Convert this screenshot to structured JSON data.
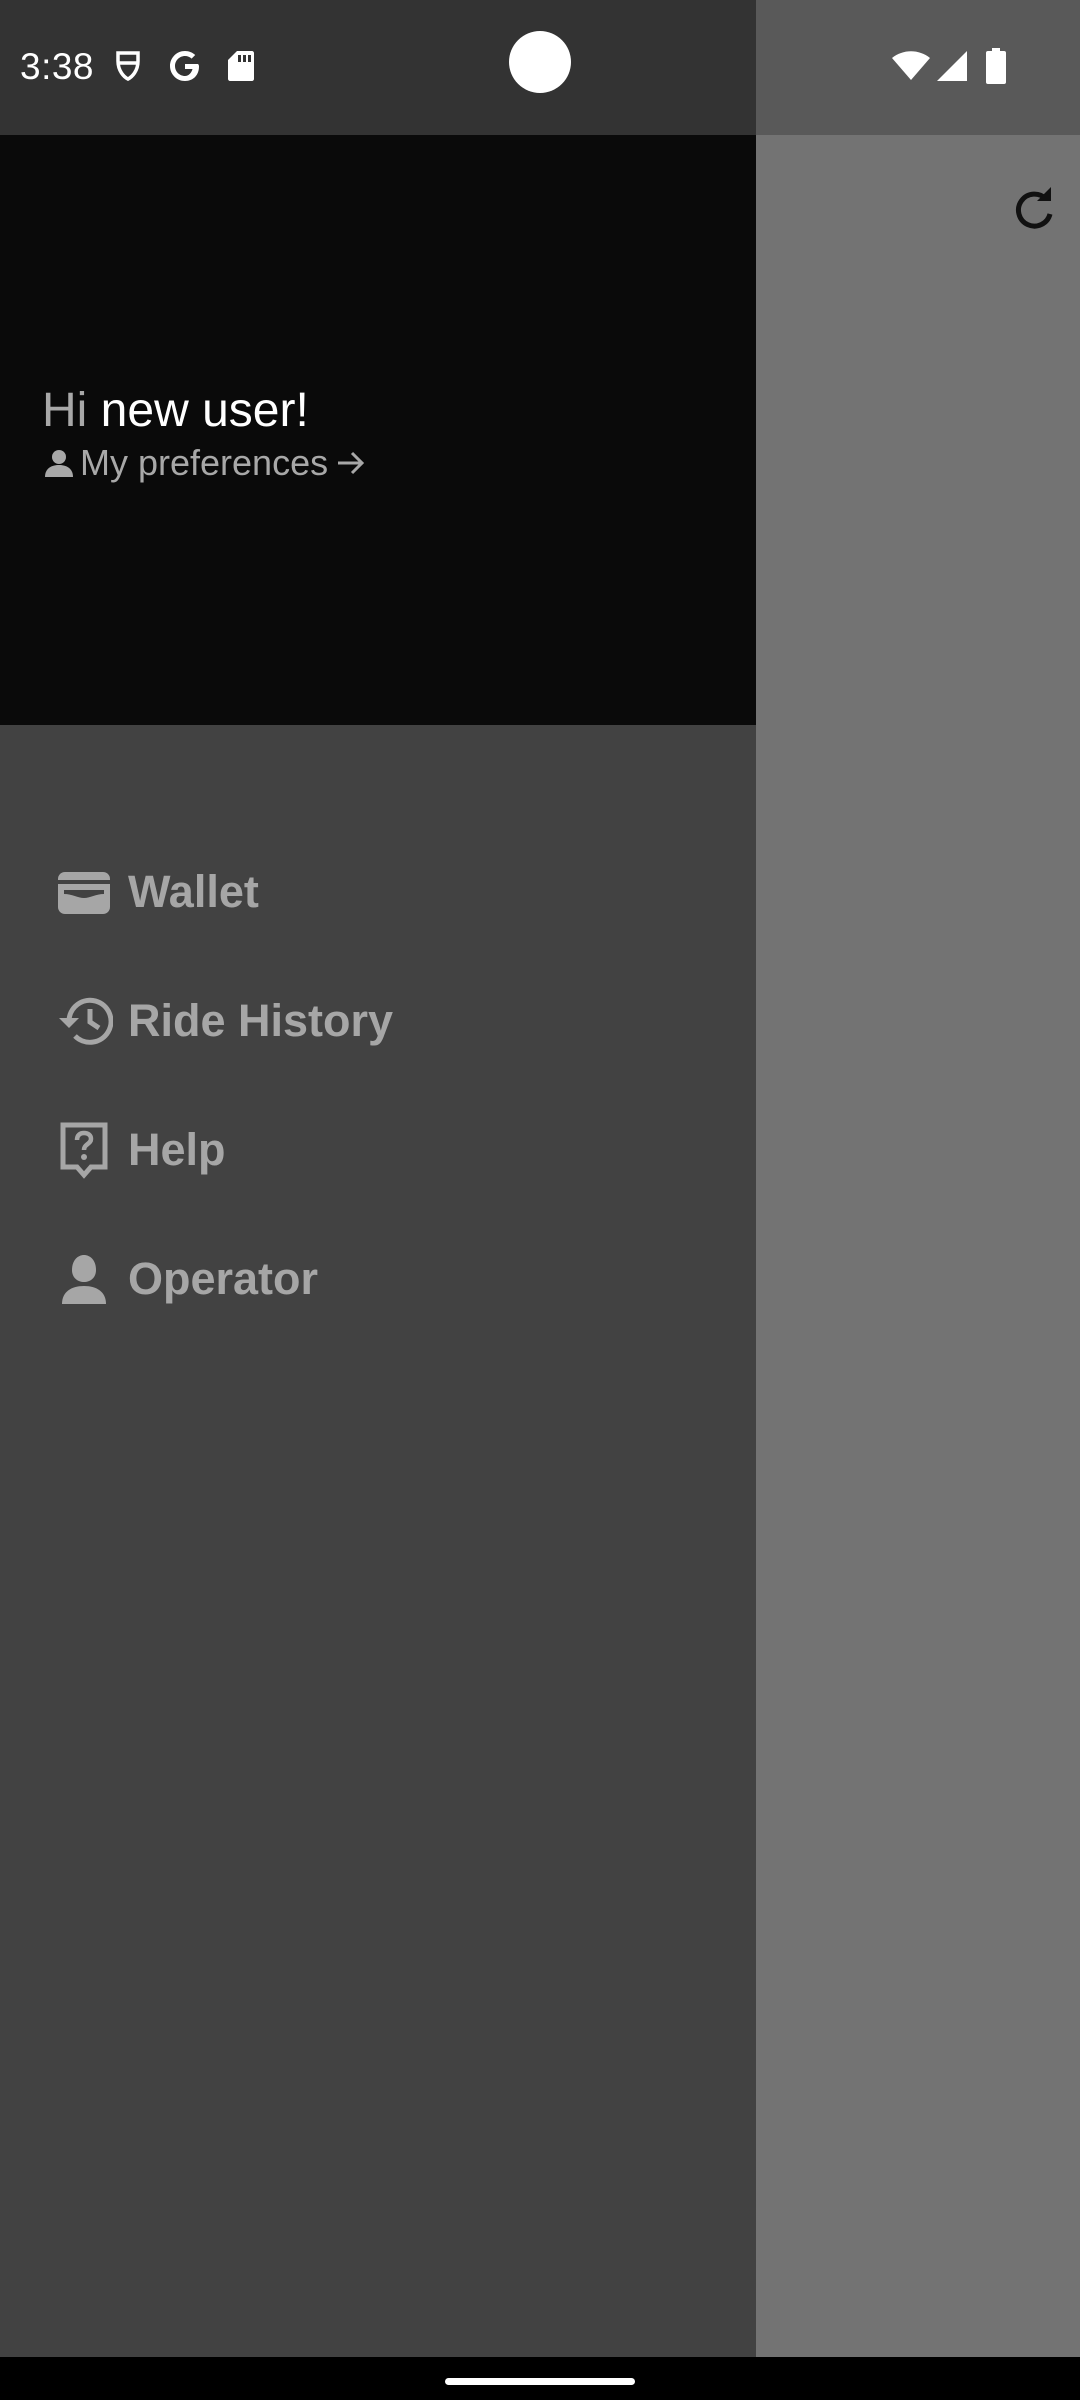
{
  "status_bar": {
    "time": "3:38",
    "left_icons": [
      "privacy-dashboard-icon",
      "google-icon",
      "sd-card-icon"
    ],
    "right_icons": [
      "wifi-icon",
      "signal-icon",
      "battery-icon"
    ]
  },
  "background": {
    "refresh_icon": "refresh-icon"
  },
  "drawer": {
    "greeting_hi": "Hi",
    "greeting_name": "new user!",
    "preferences_label": "My preferences",
    "menu": [
      {
        "label": "Wallet",
        "icon": "wallet-icon"
      },
      {
        "label": "Ride History",
        "icon": "history-icon"
      },
      {
        "label": "Help",
        "icon": "help-icon"
      },
      {
        "label": "Operator",
        "icon": "operator-icon"
      }
    ]
  },
  "colors": {
    "drawer_header": "#0a0a0a",
    "drawer_body": "#424242",
    "scrim": "#737373",
    "menu_text": "#a6a6a6"
  }
}
